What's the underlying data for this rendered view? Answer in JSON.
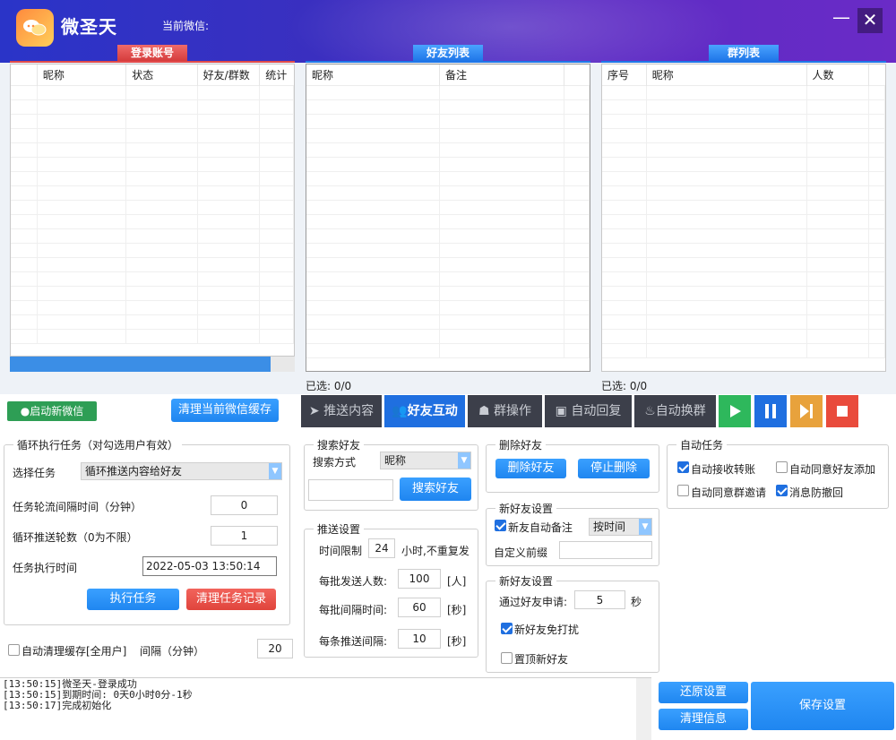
{
  "app": {
    "title": "微圣天",
    "current_wechat_label": "当前微信:"
  },
  "window_controls": {
    "minimize": "—",
    "close": "✕"
  },
  "panels": {
    "login": {
      "tab": "登录账号",
      "columns": [
        "昵称",
        "状态",
        "好友/群数",
        "统计"
      ]
    },
    "friends": {
      "tab": "好友列表",
      "columns": [
        "昵称",
        "备注"
      ],
      "selected": "已选: 0/0"
    },
    "groups": {
      "tab": "群列表",
      "columns": [
        "序号",
        "昵称",
        "人数"
      ],
      "selected": "已选: 0/0"
    }
  },
  "actions": {
    "start_wechat": "启动新微信",
    "clear_cache": "清理当前微信缓存"
  },
  "toolbar": {
    "tabs": [
      "推送内容",
      "好友互动",
      "群操作",
      "自动回复",
      "自动换群"
    ],
    "active_index": 1,
    "controls": {
      "play_color": "#2eb85c",
      "pause_color": "#1f6fe0",
      "next_color": "#e8a23c",
      "stop_color": "#e94b3c"
    }
  },
  "loop_task": {
    "title": "循环执行任务（对勾选用户有效）",
    "select_label": "选择任务",
    "select_value": "循环推送内容给好友",
    "interval_label": "任务轮流间隔时间（分钟）",
    "interval_value": "0",
    "rounds_label": "循环推送轮数（0为不限）",
    "rounds_value": "1",
    "exec_time_label": "任务执行时间",
    "exec_time_value": "2022-05-03 13:50:14",
    "execute_btn": "执行任务",
    "clear_btn": "清理任务记录"
  },
  "auto_clear": {
    "label": "自动清理缓存[全用户]",
    "interval_label": "间隔（分钟）",
    "interval_value": "20"
  },
  "search_friend": {
    "title": "搜索好友",
    "method_label": "搜索方式",
    "method_value": "昵称",
    "search_btn": "搜索好友"
  },
  "push_settings": {
    "title": "推送设置",
    "time_limit_label": "时间限制",
    "time_limit_value": "24",
    "time_limit_suffix": "小时,不重复发",
    "batch_count_label": "每批发送人数:",
    "batch_count_value": "100",
    "batch_count_unit": "[人]",
    "batch_interval_label": "每批间隔时间:",
    "batch_interval_value": "60",
    "batch_interval_unit": "[秒]",
    "item_interval_label": "每条推送间隔:",
    "item_interval_value": "10",
    "item_interval_unit": "[秒]"
  },
  "delete_friend": {
    "title": "删除好友",
    "delete_btn": "删除好友",
    "stop_btn": "停止删除"
  },
  "new_friend_settings": {
    "title": "新好友设置",
    "auto_remark_label": "新友自动备注",
    "auto_remark_checked": true,
    "remark_mode": "按时间",
    "prefix_label": "自定义前缀"
  },
  "new_friend_settings2": {
    "title": "新好友设置",
    "pass_label": "通过好友申请:",
    "pass_value": "5",
    "pass_unit": "秒",
    "no_disturb_label": "新好友免打扰",
    "no_disturb_checked": true,
    "pin_label": "置顶新好友",
    "pin_checked": false
  },
  "auto_task": {
    "title": "自动任务",
    "items": [
      {
        "label": "自动接收转账",
        "checked": true
      },
      {
        "label": "自动同意好友添加",
        "checked": false
      },
      {
        "label": "自动同意群邀请",
        "checked": false
      },
      {
        "label": "消息防撤回",
        "checked": true
      }
    ]
  },
  "log": [
    "[13:50:15]微圣天-登录成功",
    "[13:50:15]到期时间: 0天0小时0分-1秒",
    "[13:50:17]完成初始化"
  ],
  "bottom_buttons": {
    "restore": "还原设置",
    "clear_info": "清理信息",
    "save": "保存设置"
  }
}
